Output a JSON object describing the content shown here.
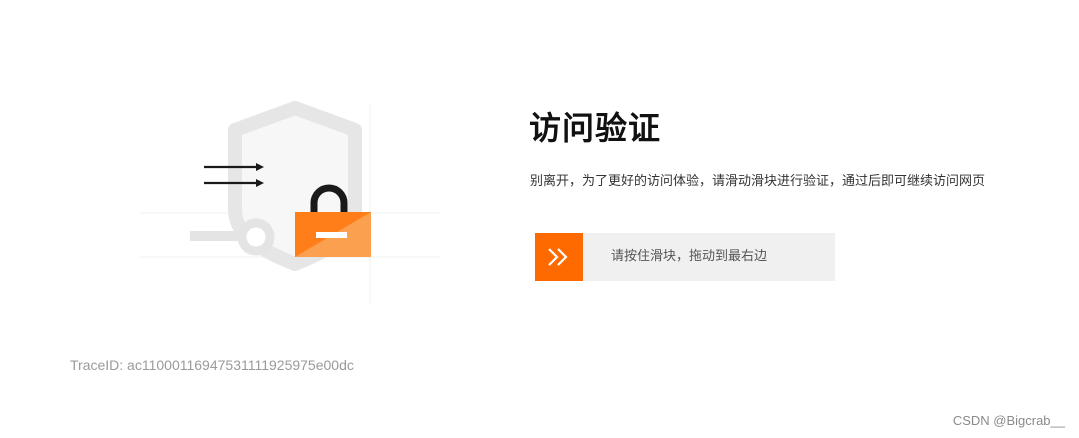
{
  "page": {
    "title": "访问验证",
    "description": "别离开，为了更好的访问体验，请滑动滑块进行验证，通过后即可继续访问网页"
  },
  "slider": {
    "label": "请按住滑块，拖动到最右边",
    "handle_icon": "double-chevron-right-icon"
  },
  "trace": {
    "text": "TraceID: ac11000116947531111925975e00dc"
  },
  "watermark": {
    "text": "CSDN @Bigcrab__"
  },
  "illustration": {
    "icon": "shield-lock-illustration"
  },
  "colors": {
    "accent": "#ff6a00",
    "lock_body": "#fba04f",
    "track": "#f0f0f0",
    "shield": "#e9e9e9"
  }
}
